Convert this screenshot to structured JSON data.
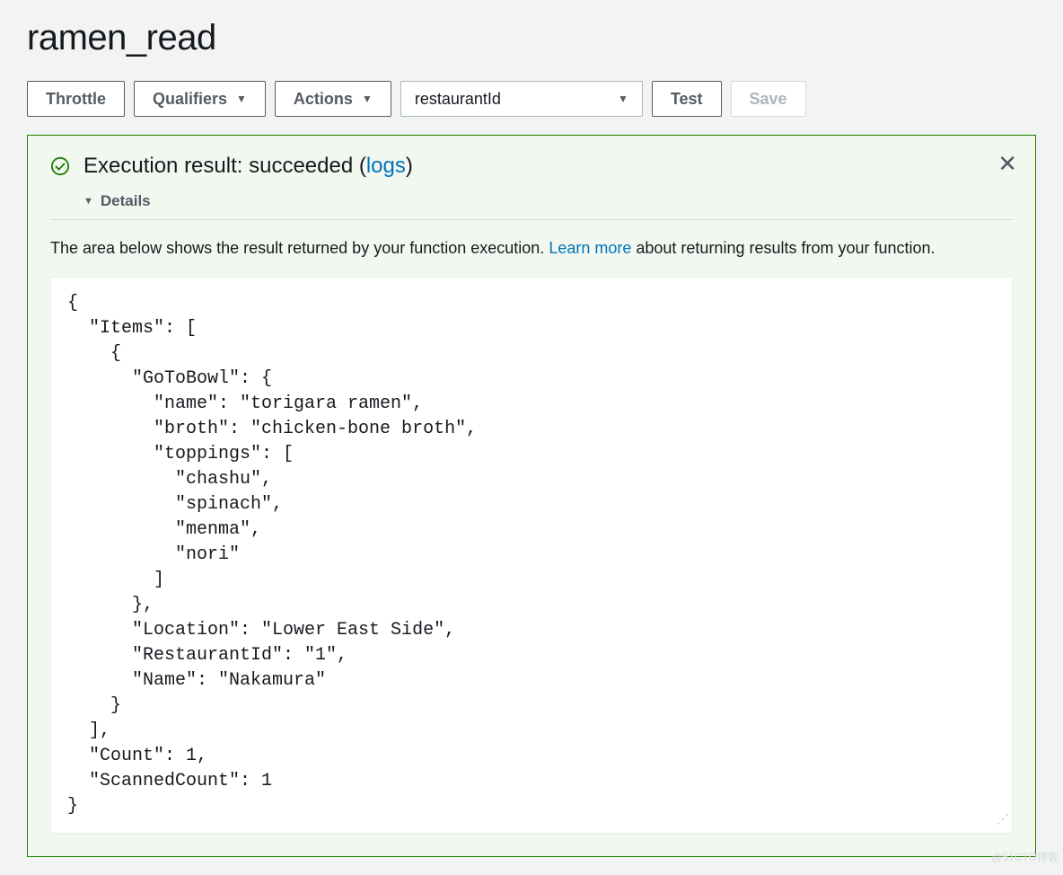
{
  "header": {
    "title": "ramen_read"
  },
  "toolbar": {
    "throttle_label": "Throttle",
    "qualifiers_label": "Qualifiers",
    "actions_label": "Actions",
    "test_event_value": "restaurantId",
    "test_label": "Test",
    "save_label": "Save"
  },
  "result": {
    "title_prefix": "Execution result: succeeded (",
    "logs_link": "logs",
    "title_suffix": ")",
    "details_label": "Details",
    "description_prefix": "The area below shows the result returned by your function execution. ",
    "learn_more": "Learn more",
    "description_suffix": " about returning results from your function.",
    "code": "{\n  \"Items\": [\n    {\n      \"GoToBowl\": {\n        \"name\": \"torigara ramen\",\n        \"broth\": \"chicken-bone broth\",\n        \"toppings\": [\n          \"chashu\",\n          \"spinach\",\n          \"menma\",\n          \"nori\"\n        ]\n      },\n      \"Location\": \"Lower East Side\",\n      \"RestaurantId\": \"1\",\n      \"Name\": \"Nakamura\"\n    }\n  ],\n  \"Count\": 1,\n  \"ScannedCount\": 1\n}"
  },
  "watermark": "@51CTO博客"
}
